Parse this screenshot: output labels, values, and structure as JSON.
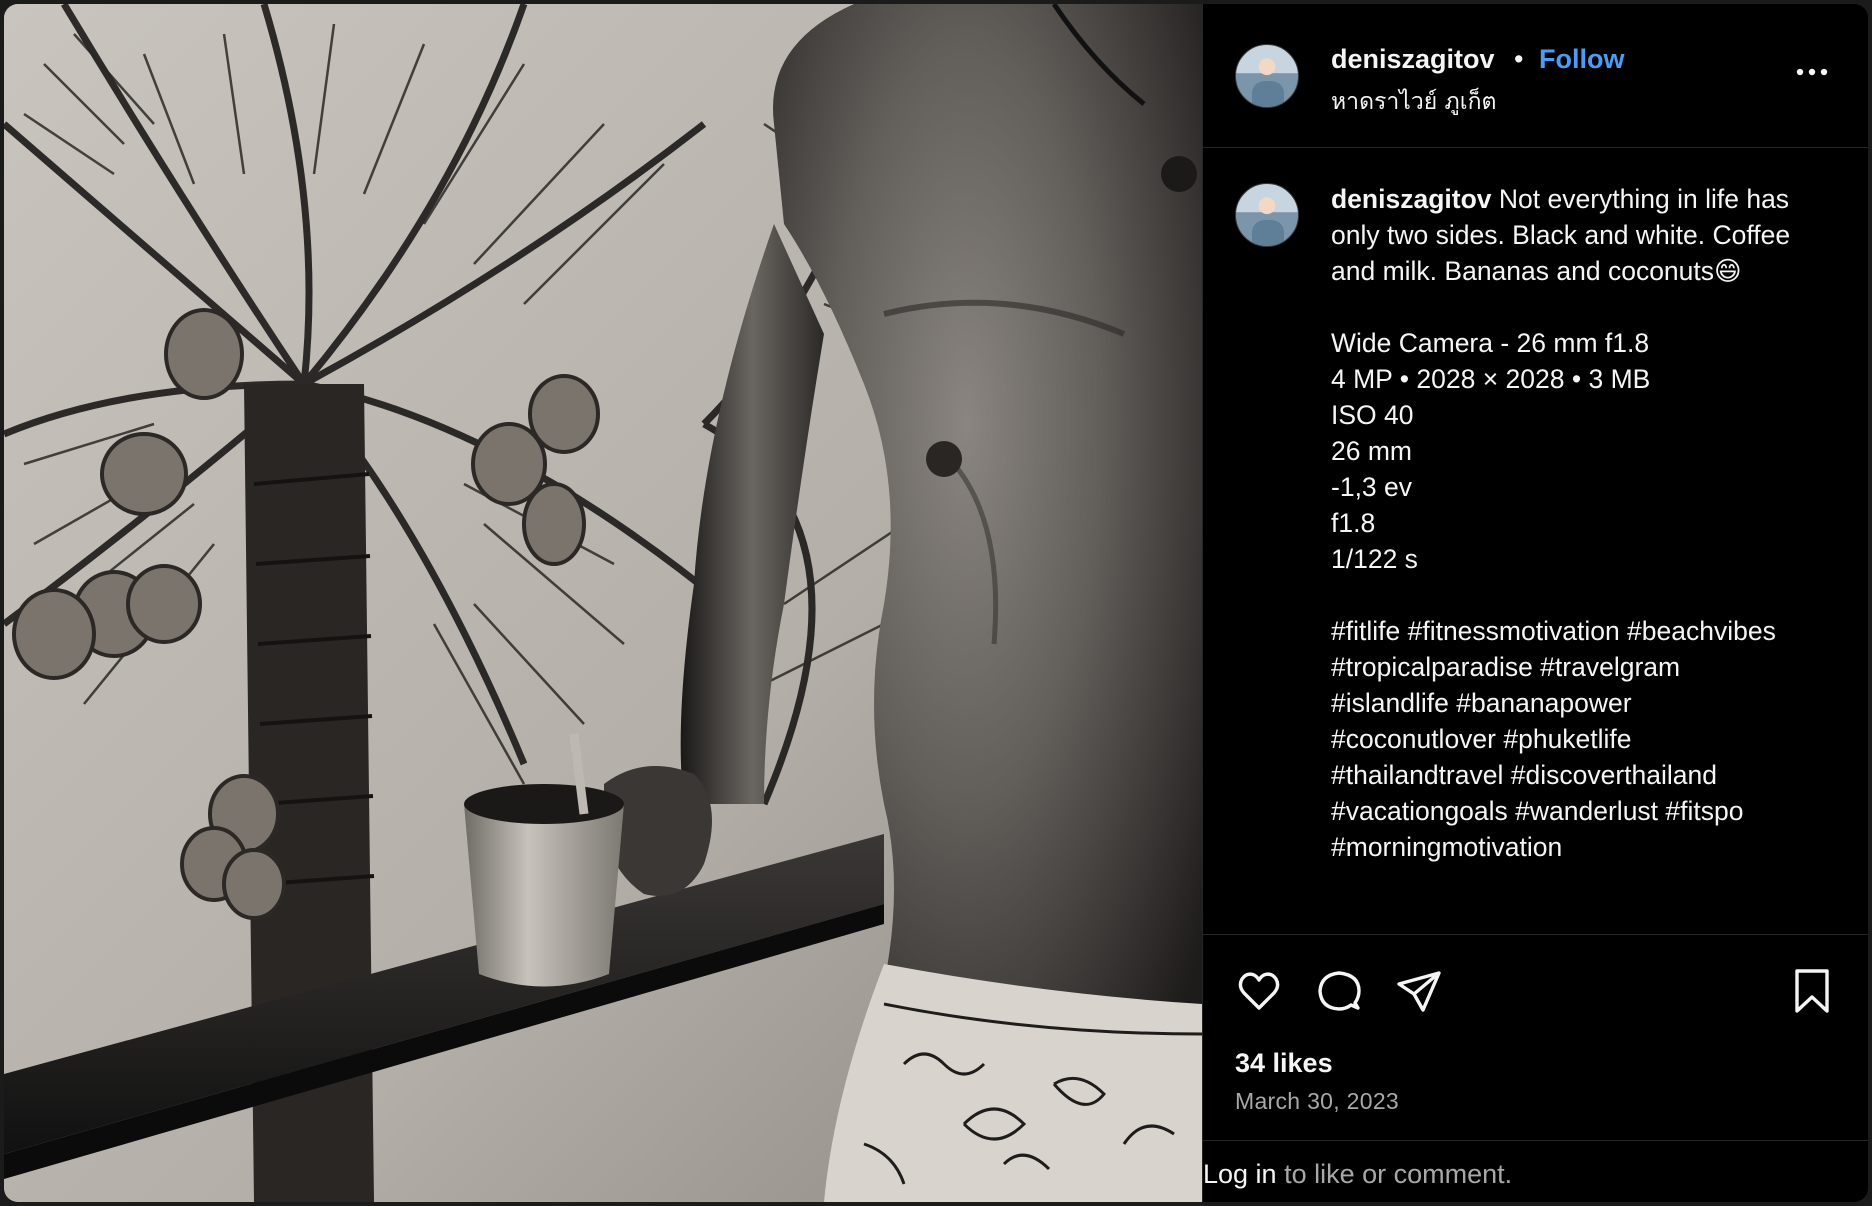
{
  "post": {
    "username": "deniszagitov",
    "separator": "•",
    "follow_label": "Follow",
    "location": "หาดราไวย์ ภูเก็ต",
    "caption_text": " Not everything in life has only two sides. Black and white. Coffee and milk. Bananas and coconuts😄\n\nWide Camera - 26 mm f1.8\n4 MP • 2028 × 2028 • 3 MB\nISO 40\n26 mm\n-1,3 ev\nf1.8\n1/122 s\n\n#fitlife #fitnessmotivation #beachvibes #tropicalparadise #travelgram #islandlife #bananapower #coconutlover #phuketlife #thailandtravel #discoverthailand #vacationgoals #wanderlust #fitspo #morningmotivation",
    "likes": "34 likes",
    "date": "March 30, 2023",
    "login_link": "Log in",
    "login_rest": " to like or comment."
  },
  "icons": {
    "more": "more-options-icon",
    "like": "heart-icon",
    "comment": "comment-icon",
    "share": "share-icon",
    "save": "bookmark-icon"
  },
  "colors": {
    "follow": "#4c9bf5",
    "background": "#000000",
    "text": "#f5f5f5",
    "secondary_text": "#a8a8a8"
  }
}
